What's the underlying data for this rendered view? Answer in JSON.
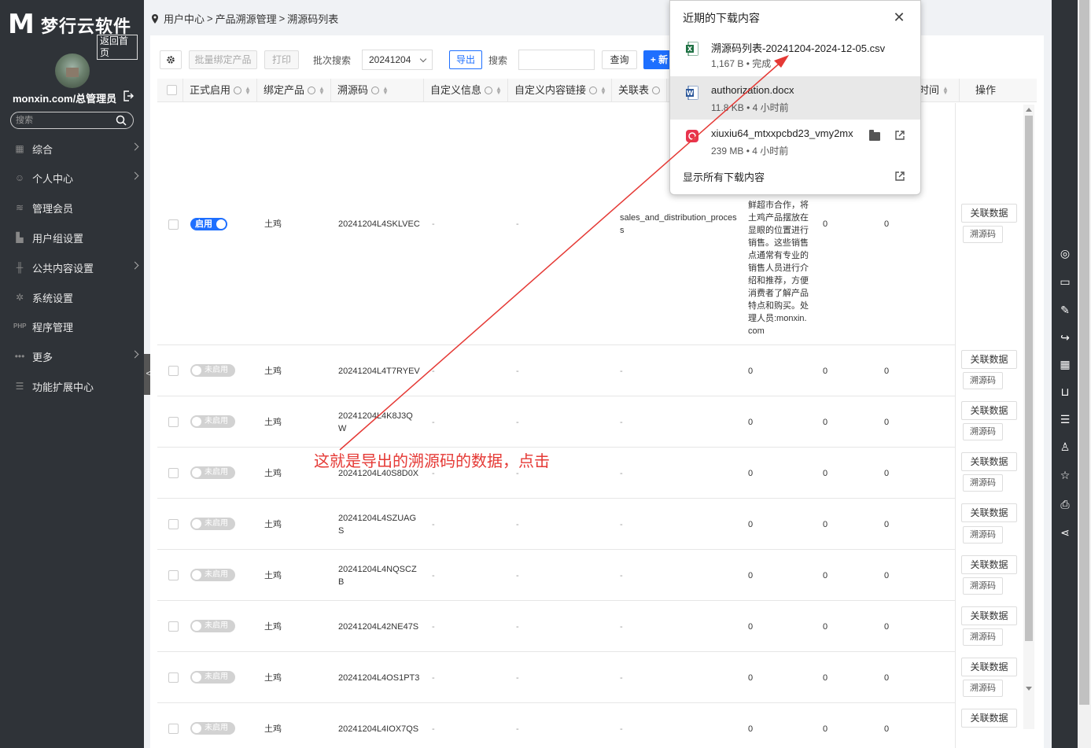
{
  "sidebar": {
    "logo_mark": "M",
    "brand": "梦行云软件",
    "home_link": "返回首页",
    "username": "monxin.com/总管理员",
    "search_placeholder": "搜索",
    "items": [
      {
        "label": "综合",
        "icon": "grid-icon",
        "has_arrow": true
      },
      {
        "label": "个人中心",
        "icon": "user-icon",
        "has_arrow": true
      },
      {
        "label": "管理会员",
        "icon": "layers-icon",
        "has_arrow": false
      },
      {
        "label": "用户组设置",
        "icon": "bar-chart-icon",
        "has_arrow": false
      },
      {
        "label": "公共内容设置",
        "icon": "tools-icon",
        "has_arrow": true
      },
      {
        "label": "系统设置",
        "icon": "gear-icon",
        "has_arrow": false
      },
      {
        "label": "程序管理",
        "icon": "php-icon",
        "has_arrow": false
      },
      {
        "label": "更多",
        "icon": "dots-icon",
        "has_arrow": true
      },
      {
        "label": "功能扩展中心",
        "icon": "menu-icon",
        "has_arrow": false
      }
    ],
    "collapse_label": "<"
  },
  "breadcrumb": [
    "用户中心",
    "产品溯源管理",
    "溯源码列表"
  ],
  "breadcrumb_sep": ">",
  "toolbar": {
    "bind_product": "批量绑定产品",
    "print": "打印",
    "batch_search_label": "批次搜索",
    "batch_value": "20241204",
    "export": "导出",
    "search_label": "搜索",
    "search_value": "",
    "query": "查询",
    "add": "+ 新"
  },
  "table": {
    "headers": [
      "正式启用",
      "绑定产品",
      "溯源码",
      "自定义信息",
      "自定义内容链接",
      "关联表",
      "时间",
      "操作"
    ],
    "rows": [
      {
        "status": "启用",
        "enabled": true,
        "product": "土鸡",
        "code": "20241204L4SKLVEC",
        "info": "-",
        "link": "-",
        "relation": "sales_and_distribution_process",
        "desc": "鲜超市合作，将土鸡产品摆放在显眼的位置进行销售。这些销售点通常有专业的销售人员进行介绍和推荐，方便消费者了解产品特点和购买。处理人员:monxin.com",
        "n1": "0",
        "n2": "0"
      },
      {
        "status": "未启用",
        "enabled": false,
        "product": "土鸡",
        "code": "20241204L4T7RYEV",
        "info": "-",
        "link": "-",
        "relation": "-",
        "desc": "0",
        "n1": "0",
        "n2": "0"
      },
      {
        "status": "未启用",
        "enabled": false,
        "product": "土鸡",
        "code": "20241204L4K8J3QW",
        "info": "-",
        "link": "-",
        "relation": "-",
        "desc": "0",
        "n1": "0",
        "n2": "0"
      },
      {
        "status": "未启用",
        "enabled": false,
        "product": "土鸡",
        "code": "20241204L40S8D0X",
        "info": "-",
        "link": "-",
        "relation": "-",
        "desc": "0",
        "n1": "0",
        "n2": "0"
      },
      {
        "status": "未启用",
        "enabled": false,
        "product": "土鸡",
        "code": "20241204L4SZUAGS",
        "info": "-",
        "link": "-",
        "relation": "-",
        "desc": "0",
        "n1": "0",
        "n2": "0"
      },
      {
        "status": "未启用",
        "enabled": false,
        "product": "土鸡",
        "code": "20241204L4NQSCZB",
        "info": "-",
        "link": "-",
        "relation": "-",
        "desc": "0",
        "n1": "0",
        "n2": "0"
      },
      {
        "status": "未启用",
        "enabled": false,
        "product": "土鸡",
        "code": "20241204L42NE47S",
        "info": "-",
        "link": "-",
        "relation": "-",
        "desc": "0",
        "n1": "0",
        "n2": "0"
      },
      {
        "status": "未启用",
        "enabled": false,
        "product": "土鸡",
        "code": "20241204L4OS1PT3",
        "info": "-",
        "link": "-",
        "relation": "-",
        "desc": "0",
        "n1": "0",
        "n2": "0"
      },
      {
        "status": "未启用",
        "enabled": false,
        "product": "土鸡",
        "code": "20241204L4IOX7QS",
        "info": "-",
        "link": "-",
        "relation": "-",
        "desc": "0",
        "n1": "0",
        "n2": "0"
      }
    ],
    "op_related": "关联数据",
    "op_trace": "溯源码"
  },
  "downloads": {
    "title": "近期的下载内容",
    "items": [
      {
        "name": "溯源码列表-20241204-2024-12-05.csv",
        "meta": "1,167 B • 完成",
        "type": "excel",
        "color": "#1f7244"
      },
      {
        "name": "authorization.docx",
        "meta": "11.8 KB • 4 小时前",
        "type": "word",
        "color": "#2b579a"
      },
      {
        "name": "xiuxiu64_mtxxpcbd23_vmy2mx",
        "meta": "239 MB • 4 小时前",
        "type": "app",
        "color": "#e8344e"
      }
    ],
    "show_all": "显示所有下载内容"
  },
  "annotation": {
    "text": "这就是导出的溯源码的数据，点击",
    "color": "#e53935"
  },
  "rightbar_icons": [
    "wechat-icon",
    "comment-icon",
    "edit-icon",
    "share-arrow-icon",
    "qrcode-icon",
    "cart-icon",
    "list-icon",
    "user-icon",
    "star-icon",
    "print-icon",
    "share-icon"
  ]
}
